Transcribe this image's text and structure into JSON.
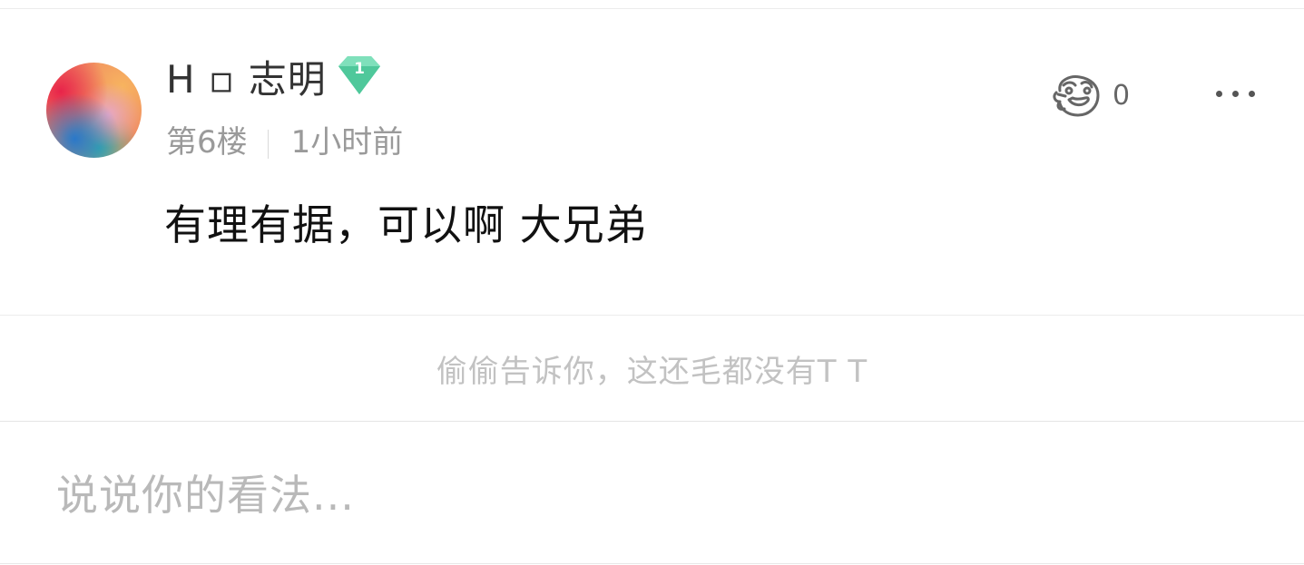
{
  "comment": {
    "username": "H ▫ 志明",
    "level": "1",
    "floor": "第6楼",
    "time": "1小时前",
    "likes": "0",
    "text": "有理有据，可以啊 大兄弟"
  },
  "replies": {
    "empty_text": "偷偷告诉你，这还毛都没有T T"
  },
  "input": {
    "placeholder": "说说你的看法..."
  },
  "icons": {
    "level_badge": "diamond-badge-icon",
    "like": "applause-face-icon",
    "more": "more-dots-icon"
  },
  "colors": {
    "badge_green": "#5fd3a6",
    "text_main": "#333333",
    "text_muted": "#9a9a9a",
    "placeholder": "#b9b9b9"
  }
}
